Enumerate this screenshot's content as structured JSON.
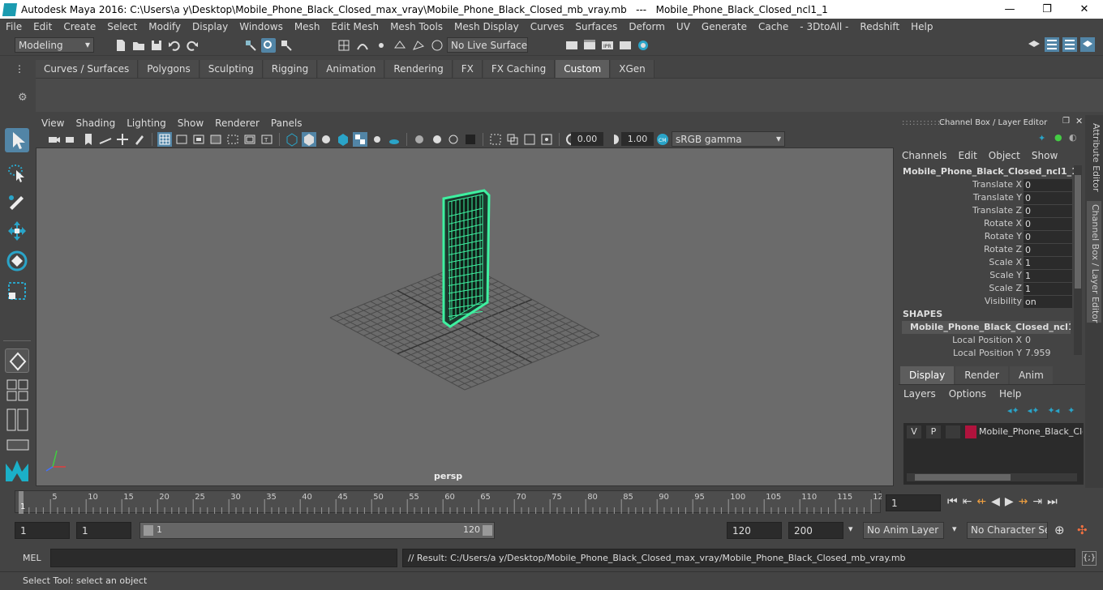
{
  "window": {
    "title": "Autodesk Maya 2016: C:\\Users\\a y\\Desktop\\Mobile_Phone_Black_Closed_max_vray\\Mobile_Phone_Black_Closed_mb_vray.mb   ---   Mobile_Phone_Black_Closed_ncl1_1",
    "minimize": "—",
    "maximize": "❐",
    "close": "✕"
  },
  "menubar": [
    "File",
    "Edit",
    "Create",
    "Select",
    "Modify",
    "Display",
    "Windows",
    "Mesh",
    "Edit Mesh",
    "Mesh Tools",
    "Mesh Display",
    "Curves",
    "Surfaces",
    "Deform",
    "UV",
    "Generate",
    "Cache",
    "- 3DtoAll -",
    "Redshift",
    "Help"
  ],
  "status": {
    "mode": "Modeling",
    "live_surface": "No Live Surface"
  },
  "shelf_tabs": [
    {
      "label": "Curves / Surfaces",
      "active": false
    },
    {
      "label": "Polygons",
      "active": false
    },
    {
      "label": "Sculpting",
      "active": false
    },
    {
      "label": "Rigging",
      "active": false
    },
    {
      "label": "Animation",
      "active": false
    },
    {
      "label": "Rendering",
      "active": false
    },
    {
      "label": "FX",
      "active": false
    },
    {
      "label": "FX Caching",
      "active": false
    },
    {
      "label": "Custom",
      "active": true
    },
    {
      "label": "XGen",
      "active": false
    }
  ],
  "viewport": {
    "menus": [
      "View",
      "Shading",
      "Lighting",
      "Show",
      "Renderer",
      "Panels"
    ],
    "exposure": "0.00",
    "gamma": "1.00",
    "color_space": "sRGB gamma",
    "camera": "persp"
  },
  "channel_box": {
    "title": "Channel Box / Layer Editor",
    "menus": [
      "Channels",
      "Edit",
      "Object",
      "Show"
    ],
    "object": "Mobile_Phone_Black_Closed_ncl1_1",
    "channels": [
      {
        "name": "Translate X",
        "value": "0"
      },
      {
        "name": "Translate Y",
        "value": "0"
      },
      {
        "name": "Translate Z",
        "value": "0"
      },
      {
        "name": "Rotate X",
        "value": "0"
      },
      {
        "name": "Rotate Y",
        "value": "0"
      },
      {
        "name": "Rotate Z",
        "value": "0"
      },
      {
        "name": "Scale X",
        "value": "1"
      },
      {
        "name": "Scale Y",
        "value": "1"
      },
      {
        "name": "Scale Z",
        "value": "1"
      },
      {
        "name": "Visibility",
        "value": "on"
      }
    ],
    "shapes_header": "SHAPES",
    "shape_name": "Mobile_Phone_Black_Closed_ncl1_1...",
    "shape_channels": [
      {
        "name": "Local Position X",
        "value": "0"
      },
      {
        "name": "Local Position Y",
        "value": "7.959"
      }
    ]
  },
  "side_tabs": {
    "attribute_editor": "Attribute Editor",
    "channel_box": "Channel Box / Layer Editor"
  },
  "layer_editor": {
    "tabs": [
      {
        "label": "Display",
        "active": true
      },
      {
        "label": "Render",
        "active": false
      },
      {
        "label": "Anim",
        "active": false
      }
    ],
    "menus": [
      "Layers",
      "Options",
      "Help"
    ],
    "layer": {
      "v": "V",
      "p": "P",
      "name": "Mobile_Phone_Black_Clc",
      "color": "#b0133d"
    }
  },
  "timeline": {
    "ticks": [
      "5",
      "10",
      "15",
      "20",
      "25",
      "30",
      "35",
      "40",
      "45",
      "50",
      "55",
      "60",
      "65",
      "70",
      "75",
      "80",
      "85",
      "90",
      "95",
      "100",
      "105",
      "110",
      "115",
      "12"
    ],
    "start_marker": "1",
    "current_frame": "1"
  },
  "range": {
    "start": "1",
    "playback_start": "1",
    "slider_start": "1",
    "slider_end": "120",
    "playback_end": "120",
    "end": "200",
    "anim_layer": "No Anim Layer",
    "character_set": "No Character Set"
  },
  "command": {
    "mel_label": "MEL",
    "result": "// Result: C:/Users/a y/Desktop/Mobile_Phone_Black_Closed_max_vray/Mobile_Phone_Black_Closed_mb_vray.mb"
  },
  "help_line": "Select Tool: select an object",
  "colors": {
    "wireframe": "#3ef0a0",
    "viewport_bg": "#6b6b6b",
    "accent": "#2aa4c8"
  }
}
